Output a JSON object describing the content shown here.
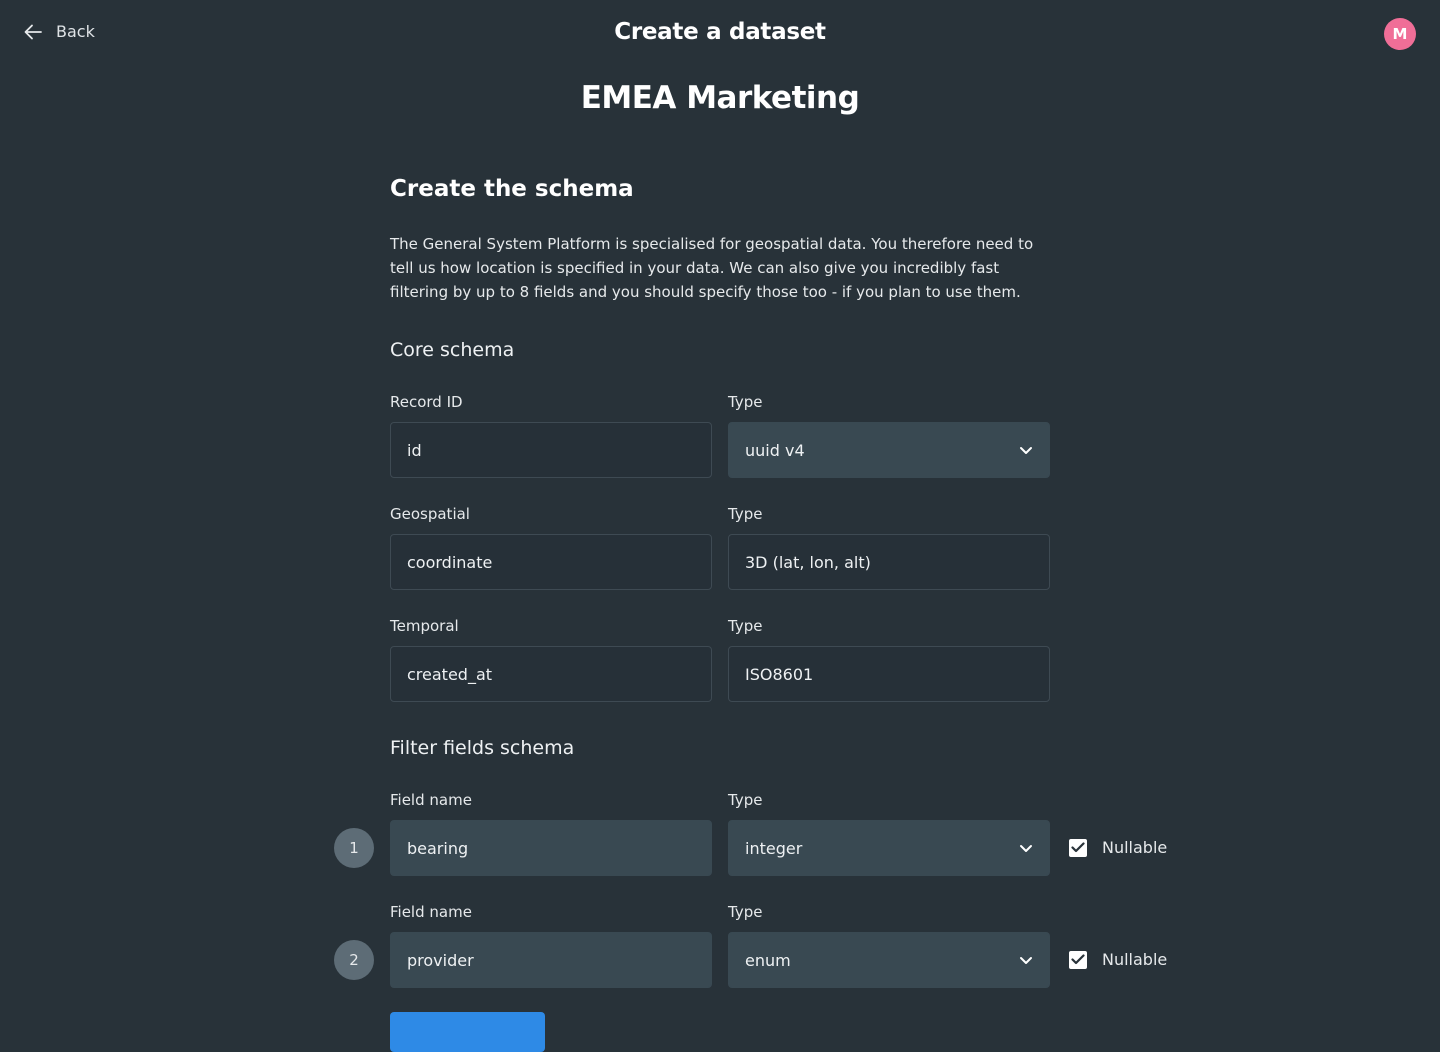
{
  "header": {
    "back_label": "Back",
    "title": "Create a dataset",
    "avatar_initial": "M"
  },
  "dataset": {
    "name": "EMEA Marketing"
  },
  "schema": {
    "title": "Create the schema",
    "description": "The General System Platform is specialised for geospatial data. You therefore need to tell us how location is specified in your data. We can also give you incredibly fast filtering by up to 8 fields and you should specify those too - if you plan to use them."
  },
  "core_schema": {
    "title": "Core schema",
    "record_id": {
      "label": "Record ID",
      "value": "id",
      "type_label": "Type",
      "type_value": "uuid v4"
    },
    "geospatial": {
      "label": "Geospatial",
      "value": "coordinate",
      "type_label": "Type",
      "type_value": "3D (lat, lon, alt)"
    },
    "temporal": {
      "label": "Temporal",
      "value": "created_at",
      "type_label": "Type",
      "type_value": "ISO8601"
    }
  },
  "filter_schema": {
    "title": "Filter fields schema",
    "fields": [
      {
        "number": "1",
        "name_label": "Field name",
        "name": "bearing",
        "type_label": "Type",
        "type": "integer",
        "nullable_label": "Nullable",
        "nullable": true
      },
      {
        "number": "2",
        "name_label": "Field name",
        "name": "provider",
        "type_label": "Type",
        "type": "enum",
        "nullable_label": "Nullable",
        "nullable": true
      }
    ]
  },
  "colors": {
    "background": "#283239",
    "avatar": "#f06e97",
    "filled_field": "#394952",
    "primary": "#2e8ae6"
  }
}
